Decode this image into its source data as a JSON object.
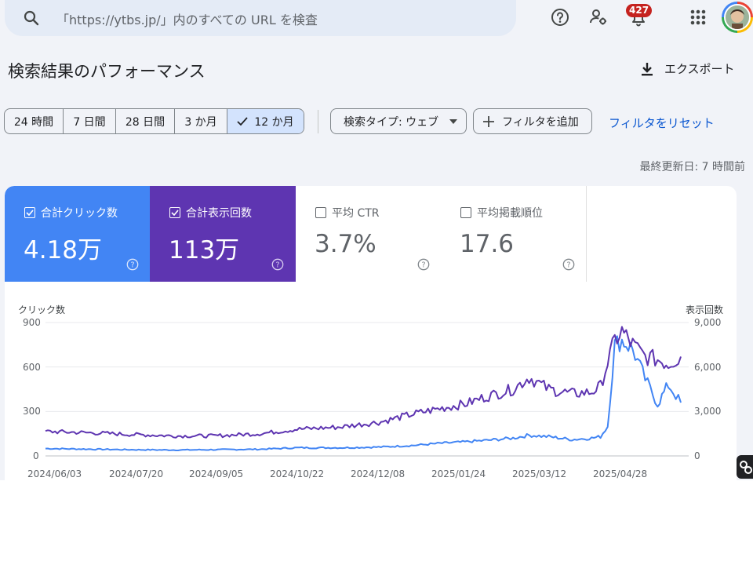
{
  "search": {
    "placeholder": "「https://ytbs.jp/」内のすべての URL を検査",
    "icon": "search-icon"
  },
  "topbar": {
    "help_icon": "help-icon",
    "admin_icon": "manage-accounts-icon",
    "notifications_icon": "notifications-icon",
    "notifications_count": "427",
    "apps_icon": "apps-grid-icon",
    "avatar_icon": "user-avatar"
  },
  "header": {
    "title": "検索結果のパフォーマンス",
    "export_label": "エクスポート",
    "export_icon": "download-icon"
  },
  "filters": {
    "date_ranges": [
      {
        "label": "24 時間",
        "selected": false
      },
      {
        "label": "7 日間",
        "selected": false
      },
      {
        "label": "28 日間",
        "selected": false
      },
      {
        "label": "3 か月",
        "selected": false
      },
      {
        "label": "12 か月",
        "selected": true
      }
    ],
    "search_type": "検索タイプ: ウェブ",
    "add_filter": "フィルタを追加",
    "reset": "フィルタをリセット"
  },
  "last_updated": "最終更新日: 7 時間前",
  "metrics": [
    {
      "label": "合計クリック数",
      "value": "4.18万",
      "checked": true,
      "color": "#4285f4"
    },
    {
      "label": "合計表示回数",
      "value": "113万",
      "checked": true,
      "color": "#5e35b1"
    },
    {
      "label": "平均 CTR",
      "value": "3.7%",
      "checked": false
    },
    {
      "label": "平均掲載順位",
      "value": "17.6",
      "checked": false
    }
  ],
  "chart_data": {
    "type": "line",
    "left_axis": {
      "label": "クリック数",
      "ticks": [
        "900",
        "600",
        "300",
        "0"
      ],
      "range": [
        0,
        900
      ]
    },
    "right_axis": {
      "label": "表示回数",
      "ticks": [
        "9,000",
        "6,000",
        "3,000",
        "0"
      ],
      "range": [
        0,
        9000
      ]
    },
    "x_ticks": [
      "2024/06/03",
      "2024/07/20",
      "2024/09/05",
      "2024/10/22",
      "2024/12/08",
      "2025/01/24",
      "2025/03/12",
      "2025/04/28"
    ],
    "x": [
      "2024/06/03",
      "2024/07/01",
      "2024/07/20",
      "2024/08/15",
      "2024/09/05",
      "2024/10/01",
      "2024/10/22",
      "2024/11/15",
      "2024/12/08",
      "2024/12/25",
      "2025/01/10",
      "2025/01/24",
      "2025/02/05",
      "2025/02/20",
      "2025/03/01",
      "2025/03/12",
      "2025/03/25",
      "2025/04/05",
      "2025/04/10",
      "2025/04/14",
      "2025/04/18",
      "2025/04/22",
      "2025/04/28",
      "2025/05/05",
      "2025/05/12",
      "2025/05/18",
      "2025/05/25"
    ],
    "series": [
      {
        "name": "合計クリック数",
        "axis": "left",
        "color": "#4285f4",
        "values": [
          50,
          45,
          42,
          40,
          42,
          45,
          55,
          55,
          60,
          70,
          85,
          95,
          105,
          120,
          140,
          130,
          110,
          120,
          130,
          200,
          750,
          780,
          720,
          520,
          350,
          480,
          360
        ]
      },
      {
        "name": "合計表示回数",
        "axis": "right",
        "color": "#5e35b1",
        "values": [
          1650,
          1550,
          1450,
          1350,
          1350,
          1500,
          1800,
          1950,
          2300,
          2800,
          3200,
          3500,
          4000,
          4500,
          5300,
          4500,
          4200,
          4300,
          4700,
          6300,
          7800,
          8400,
          7500,
          6700,
          6500,
          6200,
          6700
        ]
      }
    ]
  }
}
